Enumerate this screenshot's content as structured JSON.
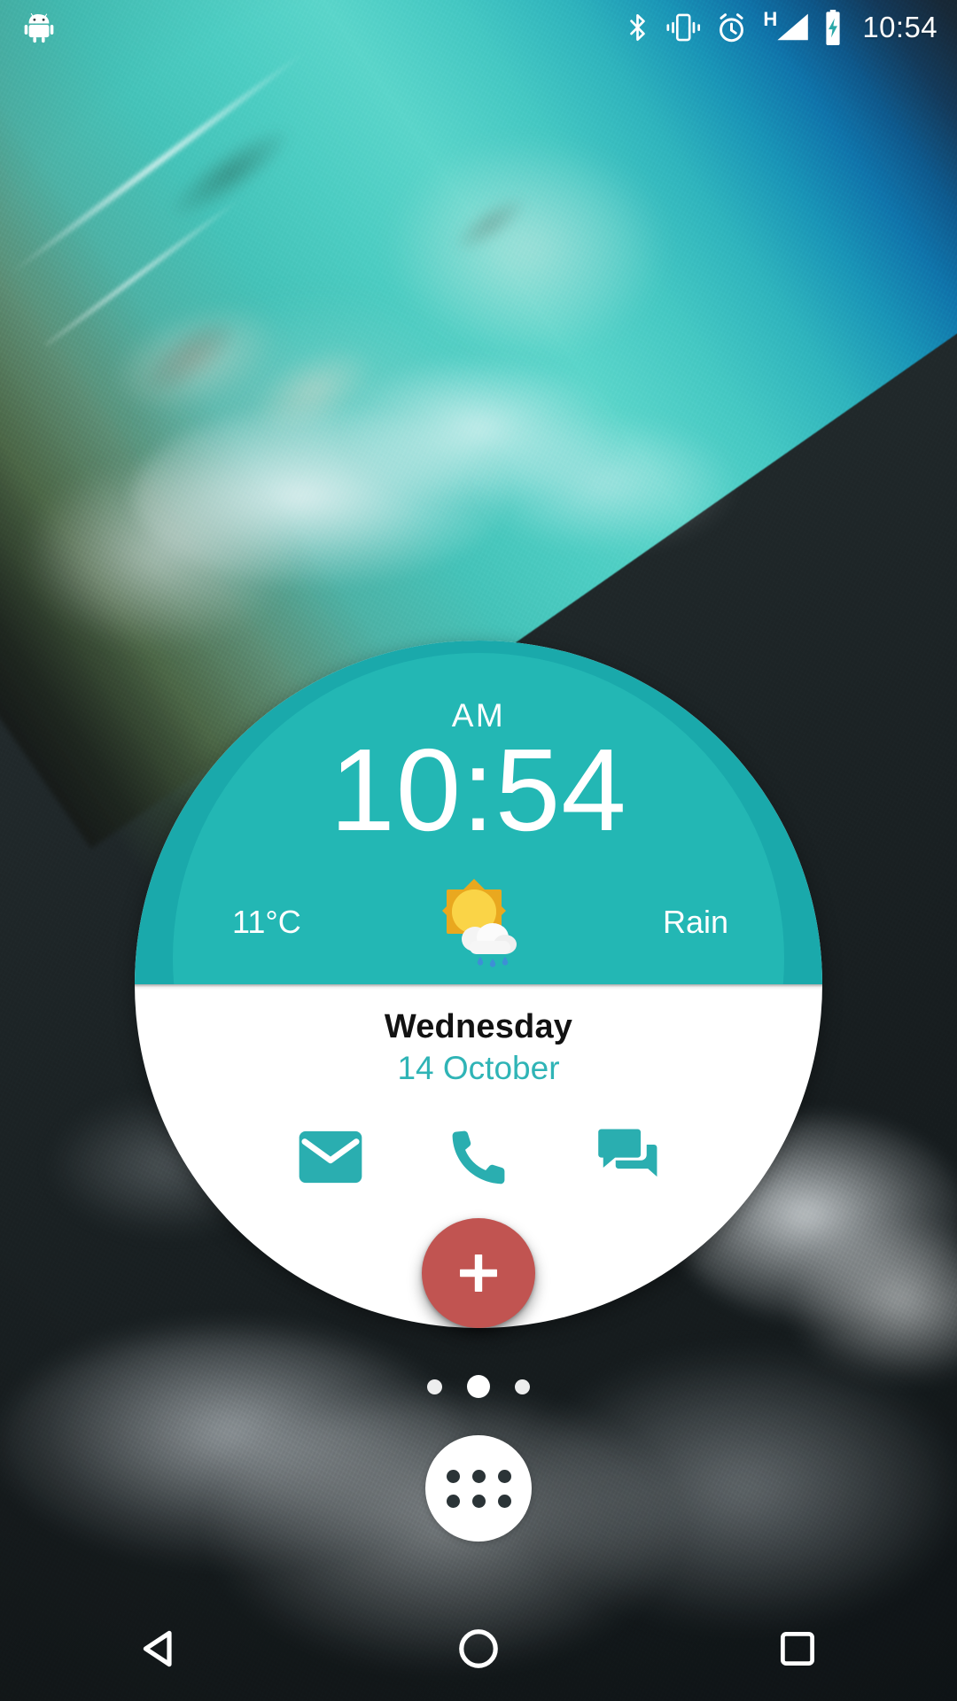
{
  "status_bar": {
    "notification_icons": [
      "android-robot-icon"
    ],
    "system_icons": [
      "bluetooth-icon",
      "vibrate-icon",
      "alarm-icon",
      "hspa-signal-icon",
      "battery-charging-icon"
    ],
    "network_type": "H",
    "clock": "10:54"
  },
  "widget": {
    "meridiem": "AM",
    "time": "10:54",
    "weather": {
      "temperature": "11°C",
      "condition": "Rain",
      "icon": "sun-behind-rain-cloud-icon"
    },
    "date": {
      "day_of_week": "Wednesday",
      "date": "14 October"
    },
    "shortcuts": [
      {
        "name": "email-shortcut",
        "icon": "envelope-icon"
      },
      {
        "name": "phone-shortcut",
        "icon": "phone-handset-icon"
      },
      {
        "name": "messaging-shortcut",
        "icon": "chat-bubbles-icon"
      }
    ],
    "fab": {
      "icon": "plus-icon",
      "color": "#c15451"
    }
  },
  "home_screen": {
    "page_indicator": {
      "pages": 3,
      "active_index": 1
    },
    "app_drawer": {
      "icon": "app-grid-icon"
    }
  },
  "nav_bar": {
    "buttons": [
      {
        "name": "back-button",
        "icon": "back-triangle-icon"
      },
      {
        "name": "home-button",
        "icon": "home-circle-icon"
      },
      {
        "name": "recents-button",
        "icon": "recents-square-icon"
      }
    ]
  },
  "colors": {
    "widget_teal": "#1aa9ab",
    "widget_teal_inner": "#23b7b4",
    "accent_teal": "#2fb4b6",
    "fab_red": "#c15451",
    "white": "#ffffff"
  }
}
